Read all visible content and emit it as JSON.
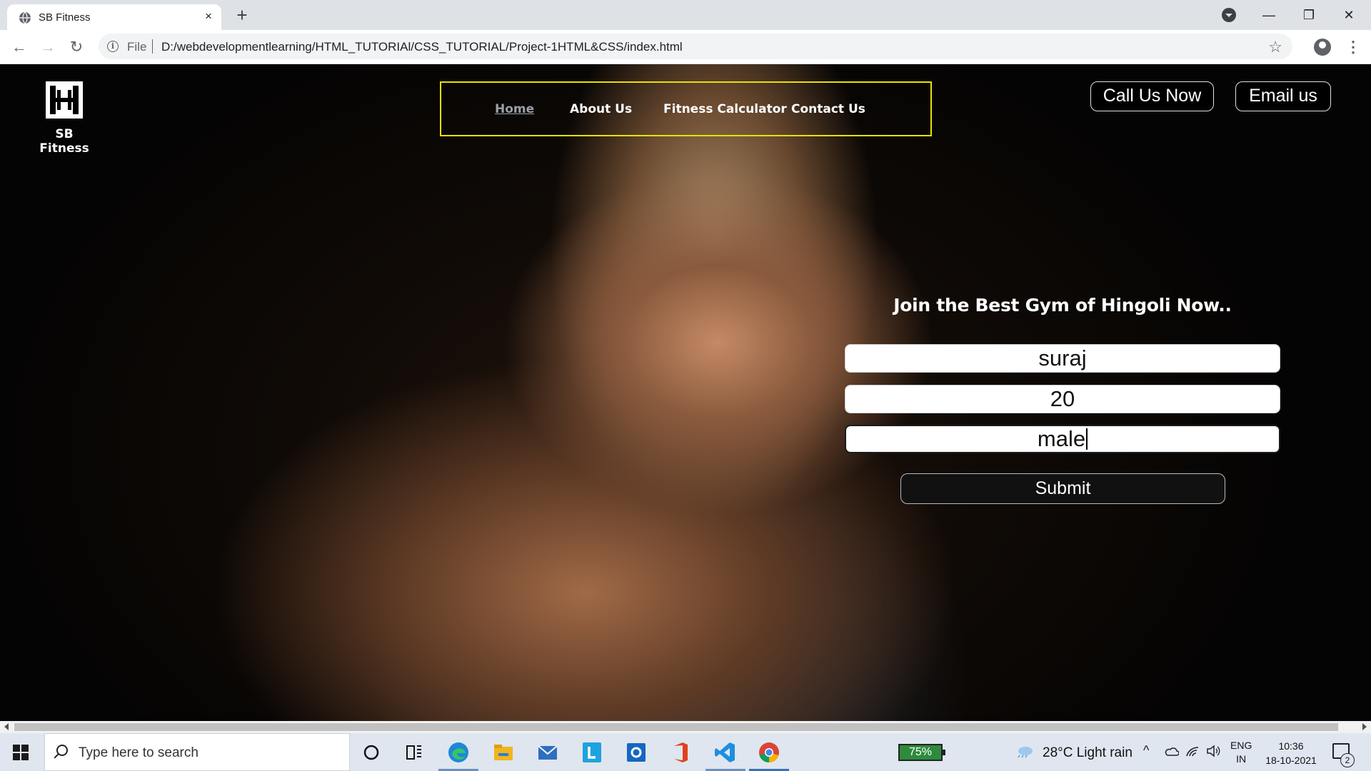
{
  "browser": {
    "tab_title": "SB Fitness",
    "tab_close": "×",
    "new_tab": "+",
    "scheme": "File",
    "url": "D:/webdevelopmentlearning/HTML_TUTORIAl/CSS_TUTORIAL/Project-1HTML&CSS/index.html",
    "window_controls": {
      "minimize": "—",
      "restore": "❐",
      "close": "✕"
    },
    "nav": {
      "back": "←",
      "forward": "→",
      "reload": "↻"
    },
    "bookmark_star": "☆",
    "menu": "⋮",
    "icons": [
      "globe-icon",
      "info-icon",
      "star-icon",
      "profile-icon",
      "kebab-menu-icon",
      "tab-search-icon"
    ]
  },
  "site": {
    "brand": "SB Fitness",
    "nav": [
      "Home",
      "About Us",
      "Fitness Calculator",
      "Contact Us"
    ],
    "active_nav": "Home",
    "cta": {
      "call": "Call Us Now",
      "email": "Email us"
    },
    "accent_color": "#e8e100",
    "form": {
      "title": "Join the Best Gym of Hingoli Now..",
      "name_value": "suraj",
      "age_value": "20",
      "gender_value": "male",
      "submit_label": "Submit"
    }
  },
  "taskbar": {
    "search_placeholder": "Type here to search",
    "battery": "75%",
    "battery_color": "#2e8b3d",
    "weather": "28°C  Light rain",
    "lang_top": "ENG",
    "lang_bottom": "IN",
    "time": "10:36",
    "date": "18-10-2021",
    "notifications": "2",
    "pinned": [
      "cortana-icon",
      "task-view-icon",
      "edge-icon",
      "file-explorer-icon",
      "mail-icon",
      "l-app-icon",
      "outlook-icon",
      "office-icon",
      "vscode-icon",
      "chrome-icon"
    ]
  }
}
